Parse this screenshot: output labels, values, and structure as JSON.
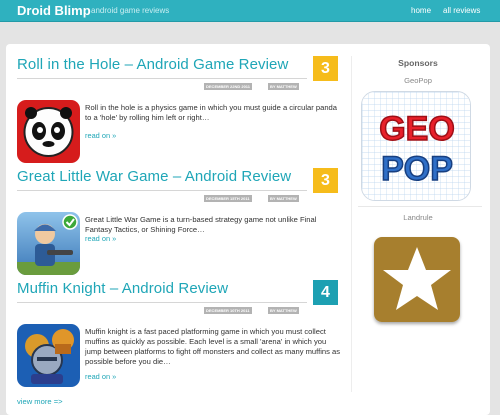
{
  "header": {
    "brand": "Droid Blimp",
    "tagline": "android game reviews",
    "nav": [
      {
        "label": "home"
      },
      {
        "label": "all reviews"
      }
    ]
  },
  "articles": [
    {
      "title": "Roll in the Hole – Android Game Review",
      "score": "3",
      "score_color": "#f6bc1b",
      "date": "DECEMBER 22ND 2011",
      "author": "BY MATTHEW",
      "excerpt": "Roll in the hole is a physics game in which you must guide a circular panda to a 'hole' by rolling him left or right…",
      "read_more": "read on »",
      "thumbnail_icon": "panda-ball-icon"
    },
    {
      "title": "Great Little War Game – Android Review",
      "score": "3",
      "score_color": "#f6bc1b",
      "date": "DECEMBER 15TH 2011",
      "author": "BY MATTHEW",
      "excerpt": "Great Little War Game is a turn-based strategy game not unlike Final Fantasy Tactics, or Shining Force…",
      "read_more": "read on »",
      "thumbnail_icon": "soldier-icon"
    },
    {
      "title": "Muffin Knight – Android Review",
      "score": "4",
      "score_color": "#1da0b2",
      "date": "DECEMBER 10TH 2011",
      "author": "BY MATTHEW",
      "excerpt": "Muffin knight is a fast paced platforming game in which you must collect muffins as quickly as possible. Each level is a small 'arena' in which you jump between platforms to fight off monsters and collect as many muffins as possible before you die…",
      "read_more": "read on »",
      "thumbnail_icon": "knight-icon"
    }
  ],
  "view_more": "view more =>",
  "sidebar": {
    "title": "Sponsors",
    "sponsors": [
      {
        "name": "GeoPop",
        "logo_text": "GEO POP",
        "icon": "geopop-logo"
      },
      {
        "name": "Landrule",
        "icon": "star-icon"
      }
    ]
  }
}
